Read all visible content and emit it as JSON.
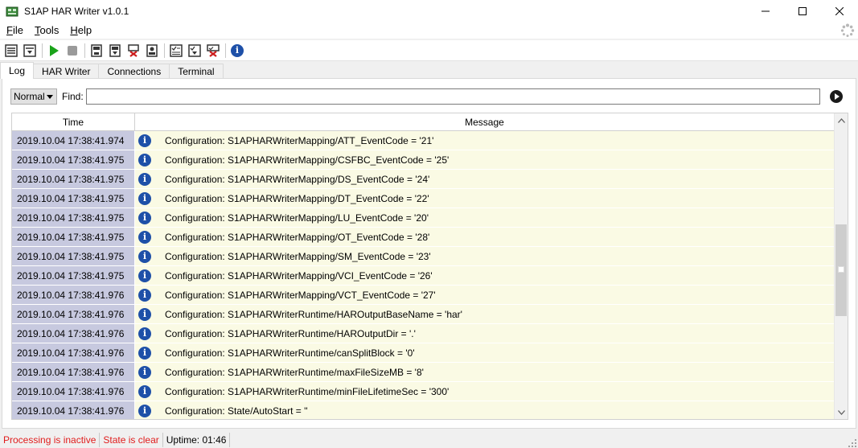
{
  "window": {
    "title": "S1AP HAR Writer v1.0.1",
    "minimize": "—",
    "maximize": "☐",
    "close": "✕"
  },
  "menu": {
    "items": [
      {
        "label": "File",
        "accel": "F",
        "rest": "ile"
      },
      {
        "label": "Tools",
        "accel": "T",
        "rest": "ools"
      },
      {
        "label": "Help",
        "accel": "H",
        "rest": "elp"
      }
    ]
  },
  "toolbar": {
    "icons": [
      "list-settings-icon",
      "list-save-icon",
      "start-icon",
      "stop-icon",
      "file-open-icon",
      "file-save-icon",
      "file-delete-icon",
      "file-print-icon",
      "checklist-icon",
      "checklist-save-icon",
      "checklist-delete-icon",
      "info-icon"
    ],
    "colors": {
      "play": "#1aa31a",
      "stop": "#9a9a9a",
      "delete": "#cc1d1d",
      "info": "#1e50a8"
    }
  },
  "tabs": [
    {
      "label": "Log",
      "active": true
    },
    {
      "label": "HAR Writer",
      "active": false
    },
    {
      "label": "Connections",
      "active": false
    },
    {
      "label": "Terminal",
      "active": false
    }
  ],
  "filter": {
    "level": "Normal",
    "find_label": "Find:",
    "find_value": ""
  },
  "grid": {
    "columns": [
      "Time",
      "Message"
    ],
    "rows": [
      {
        "time": "2019.10.04 17:38:41.974",
        "level": "info",
        "message": "Configuration: S1APHARWriterMapping/ATT_EventCode = '21'"
      },
      {
        "time": "2019.10.04 17:38:41.975",
        "level": "info",
        "message": "Configuration: S1APHARWriterMapping/CSFBC_EventCode = '25'"
      },
      {
        "time": "2019.10.04 17:38:41.975",
        "level": "info",
        "message": "Configuration: S1APHARWriterMapping/DS_EventCode = '24'"
      },
      {
        "time": "2019.10.04 17:38:41.975",
        "level": "info",
        "message": "Configuration: S1APHARWriterMapping/DT_EventCode = '22'"
      },
      {
        "time": "2019.10.04 17:38:41.975",
        "level": "info",
        "message": "Configuration: S1APHARWriterMapping/LU_EventCode = '20'"
      },
      {
        "time": "2019.10.04 17:38:41.975",
        "level": "info",
        "message": "Configuration: S1APHARWriterMapping/OT_EventCode = '28'"
      },
      {
        "time": "2019.10.04 17:38:41.975",
        "level": "info",
        "message": "Configuration: S1APHARWriterMapping/SM_EventCode = '23'"
      },
      {
        "time": "2019.10.04 17:38:41.975",
        "level": "info",
        "message": "Configuration: S1APHARWriterMapping/VCI_EventCode = '26'"
      },
      {
        "time": "2019.10.04 17:38:41.976",
        "level": "info",
        "message": "Configuration: S1APHARWriterMapping/VCT_EventCode = '27'"
      },
      {
        "time": "2019.10.04 17:38:41.976",
        "level": "info",
        "message": "Configuration: S1APHARWriterRuntime/HAROutputBaseName = 'har'"
      },
      {
        "time": "2019.10.04 17:38:41.976",
        "level": "info",
        "message": "Configuration: S1APHARWriterRuntime/HAROutputDir = '.'"
      },
      {
        "time": "2019.10.04 17:38:41.976",
        "level": "info",
        "message": "Configuration: S1APHARWriterRuntime/canSplitBlock = '0'"
      },
      {
        "time": "2019.10.04 17:38:41.976",
        "level": "info",
        "message": "Configuration: S1APHARWriterRuntime/maxFileSizeMB = '8'"
      },
      {
        "time": "2019.10.04 17:38:41.976",
        "level": "info",
        "message": "Configuration: S1APHARWriterRuntime/minFileLifetimeSec = '300'"
      },
      {
        "time": "2019.10.04 17:38:41.976",
        "level": "info",
        "message": "Configuration: State/AutoStart = ''"
      }
    ],
    "colors": {
      "time_bg": "#c7c9df",
      "msg_bg": "#fafae4",
      "info": "#1e50a8"
    }
  },
  "status": {
    "processing": "Processing is inactive",
    "state": "State is clear",
    "uptime": "Uptime: 01:46",
    "alert_color": "#e01c1c"
  }
}
